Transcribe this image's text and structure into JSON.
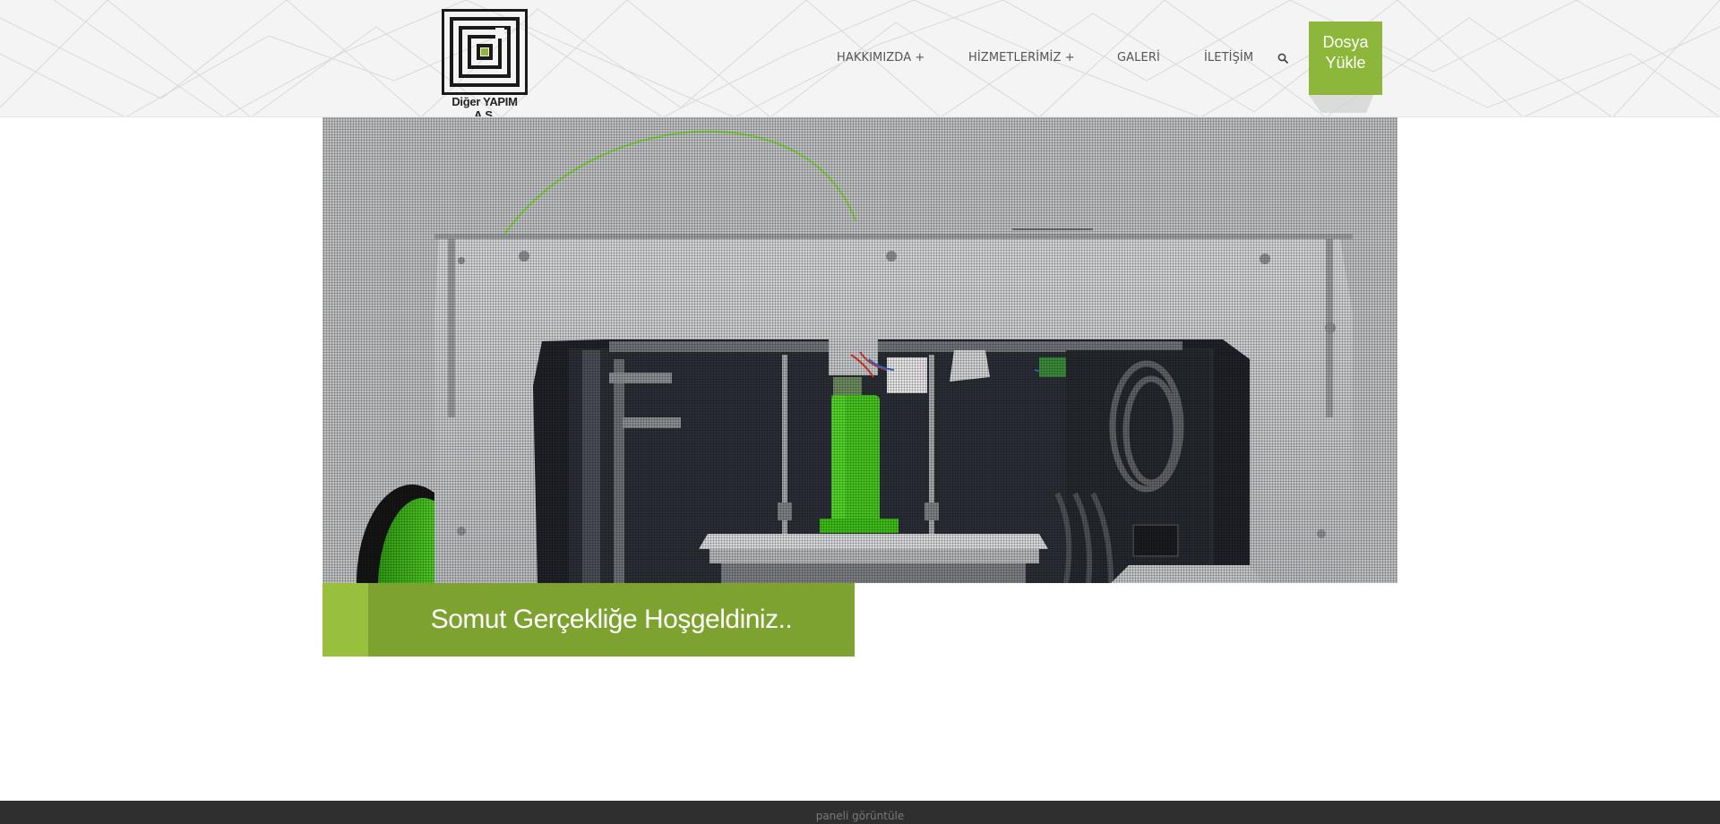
{
  "brand": {
    "logo_text": "Diğer YAPIM A.Ş.",
    "accent_color": "#8cb73a"
  },
  "nav": {
    "items": [
      {
        "label": "HAKKIMIZDA +"
      },
      {
        "label": "HİZMETLERİMİZ +"
      },
      {
        "label": "GALERİ"
      },
      {
        "label": "İLETİŞİM"
      }
    ],
    "search_icon": "search-icon"
  },
  "upload_button": {
    "line1": "Dosya",
    "line2": "Yükle"
  },
  "hero": {
    "caption": "Somut Gerçekliğe Hoşgeldiniz.."
  },
  "footer": {
    "text": "paneli görüntüle"
  }
}
